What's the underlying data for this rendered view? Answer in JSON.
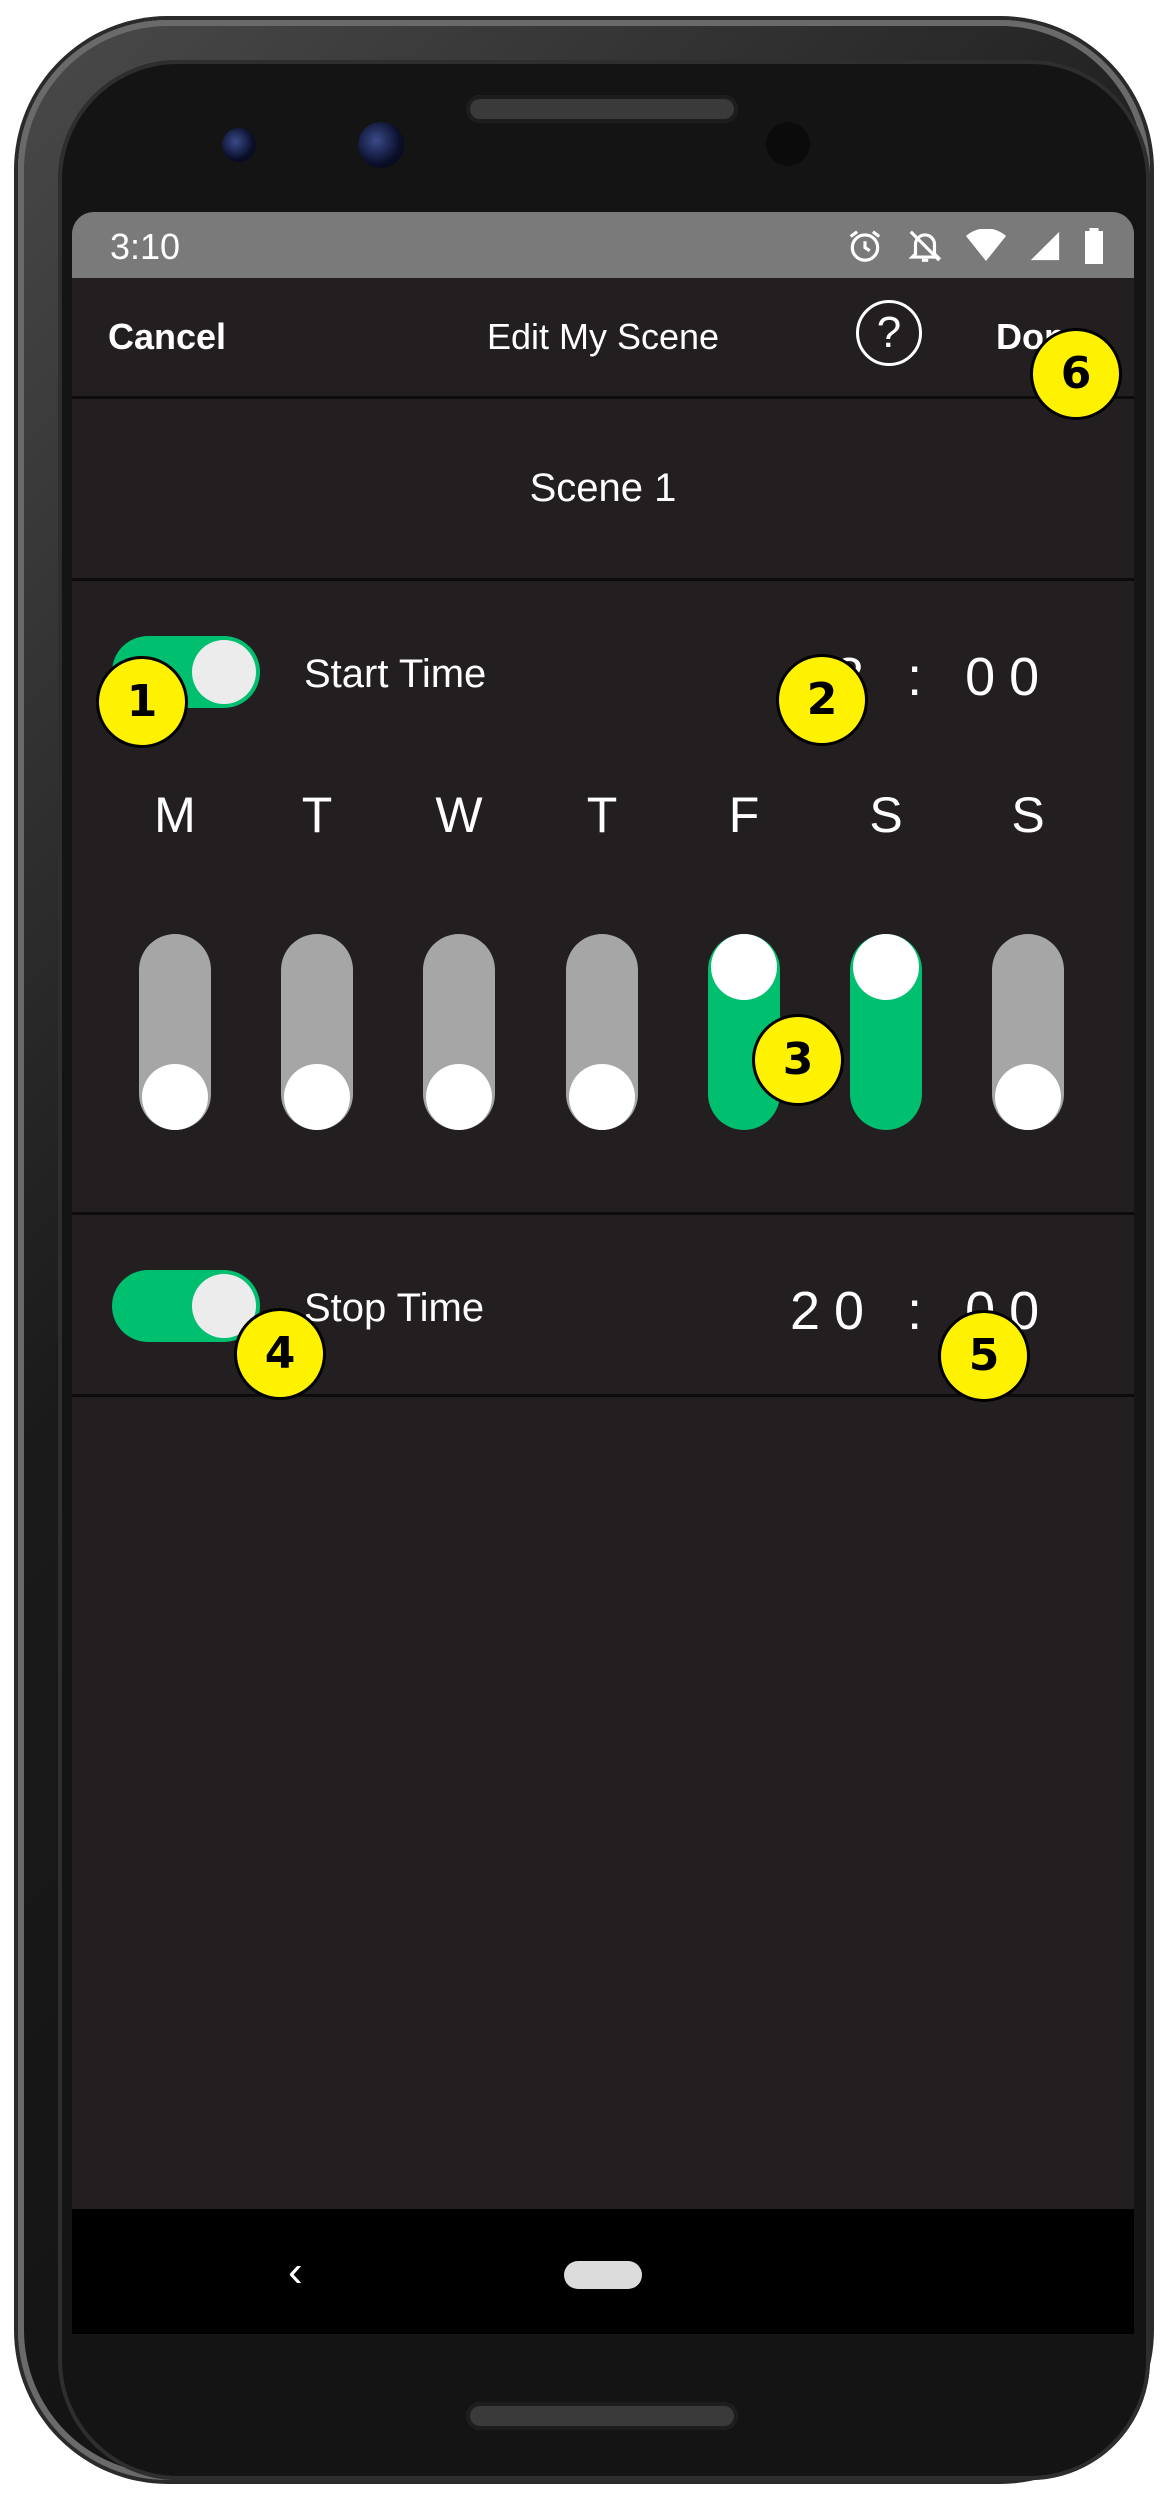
{
  "status_bar": {
    "time": "3:10",
    "icons": [
      "alarm-icon",
      "notifications-off-icon",
      "wifi-icon",
      "signal-icon",
      "battery-icon"
    ]
  },
  "header": {
    "cancel_label": "Cancel",
    "title": "Edit My Scene",
    "help_label": "?",
    "done_label": "Done"
  },
  "scene": {
    "name": "Scene 1"
  },
  "start": {
    "label": "Start Time",
    "enabled": true,
    "time_display": "18 : 00"
  },
  "days": [
    {
      "label": "M",
      "on": false
    },
    {
      "label": "T",
      "on": false
    },
    {
      "label": "W",
      "on": false
    },
    {
      "label": "T",
      "on": false
    },
    {
      "label": "F",
      "on": true
    },
    {
      "label": "S",
      "on": true
    },
    {
      "label": "S",
      "on": false
    }
  ],
  "stop": {
    "label": "Stop Time",
    "enabled": true,
    "time_display": "20 : 00"
  },
  "nav": {
    "back_glyph": "‹"
  },
  "callouts": [
    "1",
    "2",
    "3",
    "4",
    "5",
    "6"
  ],
  "colors": {
    "accent_green": "#00bf6f",
    "background": "#231f20",
    "switch_off": "#a6a6a6",
    "callout_yellow": "#fff200"
  }
}
